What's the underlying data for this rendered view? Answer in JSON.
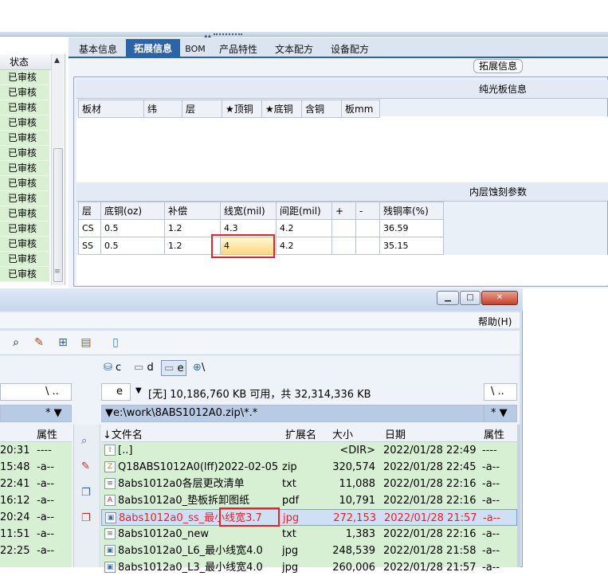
{
  "erp": {
    "status_header": "状态",
    "status_rows": [
      "已审核",
      "已审核",
      "已审核",
      "已审核",
      "已审核",
      "已审核",
      "已审核",
      "已审核",
      "已审核",
      "已审核",
      "已审核",
      "已审核",
      "已审核",
      "已审核"
    ],
    "tabs": [
      "基本信息",
      "拓展信息",
      "BOM",
      "产品特性",
      "文本配方",
      "设备配方"
    ],
    "active_tab": "拓展信息",
    "group_label": "拓展信息",
    "board_section_title": "纯光板信息",
    "board_headers": [
      "板材",
      "纬",
      "层",
      "★顶铜",
      "★底铜",
      "含铜",
      "板mm"
    ],
    "etch_section_title": "内层蚀刻参数",
    "etch_headers": [
      "层",
      "底铜(oz)",
      "补偿",
      "线宽(mil)",
      "间距(mil)",
      "+",
      "-",
      "残铜率(%)"
    ],
    "etch_rows": [
      [
        "CS",
        "0.5",
        "1.2",
        "4.3",
        "4.2",
        "",
        "",
        "36.59"
      ],
      [
        "SS",
        "0.5",
        "1.2",
        "4",
        "4.2",
        "",
        "",
        "35.15"
      ]
    ]
  },
  "fm": {
    "help_menu": "帮助(H)",
    "drives": {
      "c": "c",
      "d": "d",
      "e": "e",
      "net": "\\"
    },
    "left_path_suffix": "\\  ..",
    "left_filter": "*",
    "drive_select": "e",
    "free_space": "[无]  10,186,760 KB 可用，共 32,314,336 KB",
    "right_path_suffix": "\\  ..",
    "current_path": "e:\\work\\8ABS1012A0.zip\\*.*",
    "right_filter": "*",
    "left_attr_header": "属性",
    "left_rows": [
      {
        "time": "20:31",
        "attr": "----"
      },
      {
        "time": "15:48",
        "attr": "-a--"
      },
      {
        "time": "22:41",
        "attr": "-a--"
      },
      {
        "time": "16:12",
        "attr": "-a--"
      },
      {
        "time": "20:24",
        "attr": "-a--"
      },
      {
        "time": "11:51",
        "attr": "-a--"
      },
      {
        "time": "22:25",
        "attr": "-a--"
      }
    ],
    "columns": {
      "name": "↓文件名",
      "ext": "扩展名",
      "size": "大小",
      "date": "日期",
      "attr": "属性"
    },
    "files": [
      {
        "name": "[..]",
        "ext": "",
        "size": "<DIR>",
        "date": "2022/01/28 22:49",
        "attr": "----",
        "icon": "up-folder-icon"
      },
      {
        "name": "Q18ABS1012A0(lff)2022-02-05",
        "ext": "zip",
        "size": "320,574",
        "date": "2022/01/28 22:45",
        "attr": "-a--",
        "icon": "zip-icon"
      },
      {
        "name": "8abs1012a0各层更改清单",
        "ext": "txt",
        "size": "11,088",
        "date": "2022/01/28 22:16",
        "attr": "-a--",
        "icon": "txt-icon"
      },
      {
        "name": "8abs1012a0_垫板拆卸图纸",
        "ext": "pdf",
        "size": "10,791",
        "date": "2022/01/28 22:16",
        "attr": "-a--",
        "icon": "pdf-icon"
      },
      {
        "name": "8abs1012a0_ss_最小线宽3.7",
        "ext": "jpg",
        "size": "272,153",
        "date": "2022/01/28 21:57",
        "attr": "-a--",
        "icon": "image-icon"
      },
      {
        "name": "8abs1012a0_new",
        "ext": "txt",
        "size": "1,383",
        "date": "2022/01/28 22:16",
        "attr": "-a--",
        "icon": "txt-icon"
      },
      {
        "name": "8abs1012a0_L6_最小线宽4.0",
        "ext": "jpg",
        "size": "248,539",
        "date": "2022/01/28 21:58",
        "attr": "-a--",
        "icon": "image-icon"
      },
      {
        "name": "8abs1012a0_L3_最小线宽4.0",
        "ext": "jpg",
        "size": "260,006",
        "date": "2022/01/28 21:57",
        "attr": "-a--",
        "icon": "image-icon"
      }
    ],
    "selected_index": 4
  }
}
